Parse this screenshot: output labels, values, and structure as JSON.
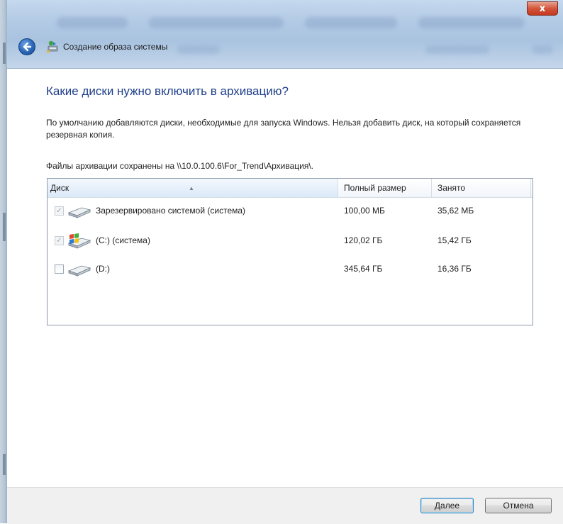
{
  "window": {
    "title": "Создание образа системы",
    "close_label": "x"
  },
  "page": {
    "heading": "Какие диски нужно включить в архивацию?",
    "description": "По умолчанию добавляются диски, необходимые для запуска Windows. Нельзя добавить диск, на который сохраняется резервная копия.",
    "save_location": "Файлы архивации сохранены на \\\\10.0.100.6\\For_Trend\\Архивация\\."
  },
  "table": {
    "columns": [
      "Диск",
      "Полный размер",
      "Занято"
    ],
    "rows": [
      {
        "name": "Зарезервировано системой (система)",
        "total": "100,00 МБ",
        "used": "35,62 МБ",
        "checked": true,
        "disabled": true,
        "icon": "drive-icon"
      },
      {
        "name": "(C:) (система)",
        "total": "120,02 ГБ",
        "used": "15,42 ГБ",
        "checked": true,
        "disabled": true,
        "icon": "windows-drive-icon"
      },
      {
        "name": "(D:)",
        "total": "345,64 ГБ",
        "used": "16,36 ГБ",
        "checked": false,
        "disabled": false,
        "icon": "drive-icon"
      }
    ]
  },
  "buttons": {
    "next": "Далее",
    "cancel": "Отмена"
  },
  "colors": {
    "heading": "#1e3f8a",
    "close_button": "#c4391f",
    "titlebar": "#b1c9e4"
  }
}
